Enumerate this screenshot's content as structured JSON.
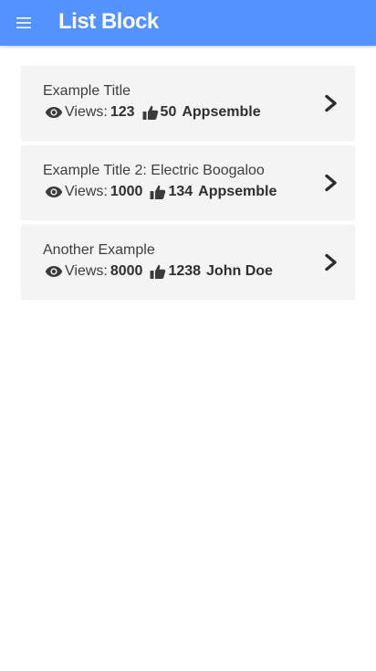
{
  "header": {
    "title": "List Block",
    "background": "#5393ff",
    "menu_icon": "hamburger-menu-icon"
  },
  "list": {
    "items": [
      {
        "title": "Example Title",
        "views_label": "Views:",
        "views": "123",
        "likes": "50",
        "author": "Appsemble"
      },
      {
        "title": "Example Title 2: Electric Boogaloo",
        "views_label": "Views:",
        "views": "1000",
        "likes": "134",
        "author": "Appsemble"
      },
      {
        "title": "Another Example",
        "views_label": "Views:",
        "views": "8000",
        "likes": "1238",
        "author": "John Doe"
      }
    ],
    "item_icons": [
      "eye-icon",
      "thumbs-up-icon",
      "chevron-right-icon"
    ]
  }
}
